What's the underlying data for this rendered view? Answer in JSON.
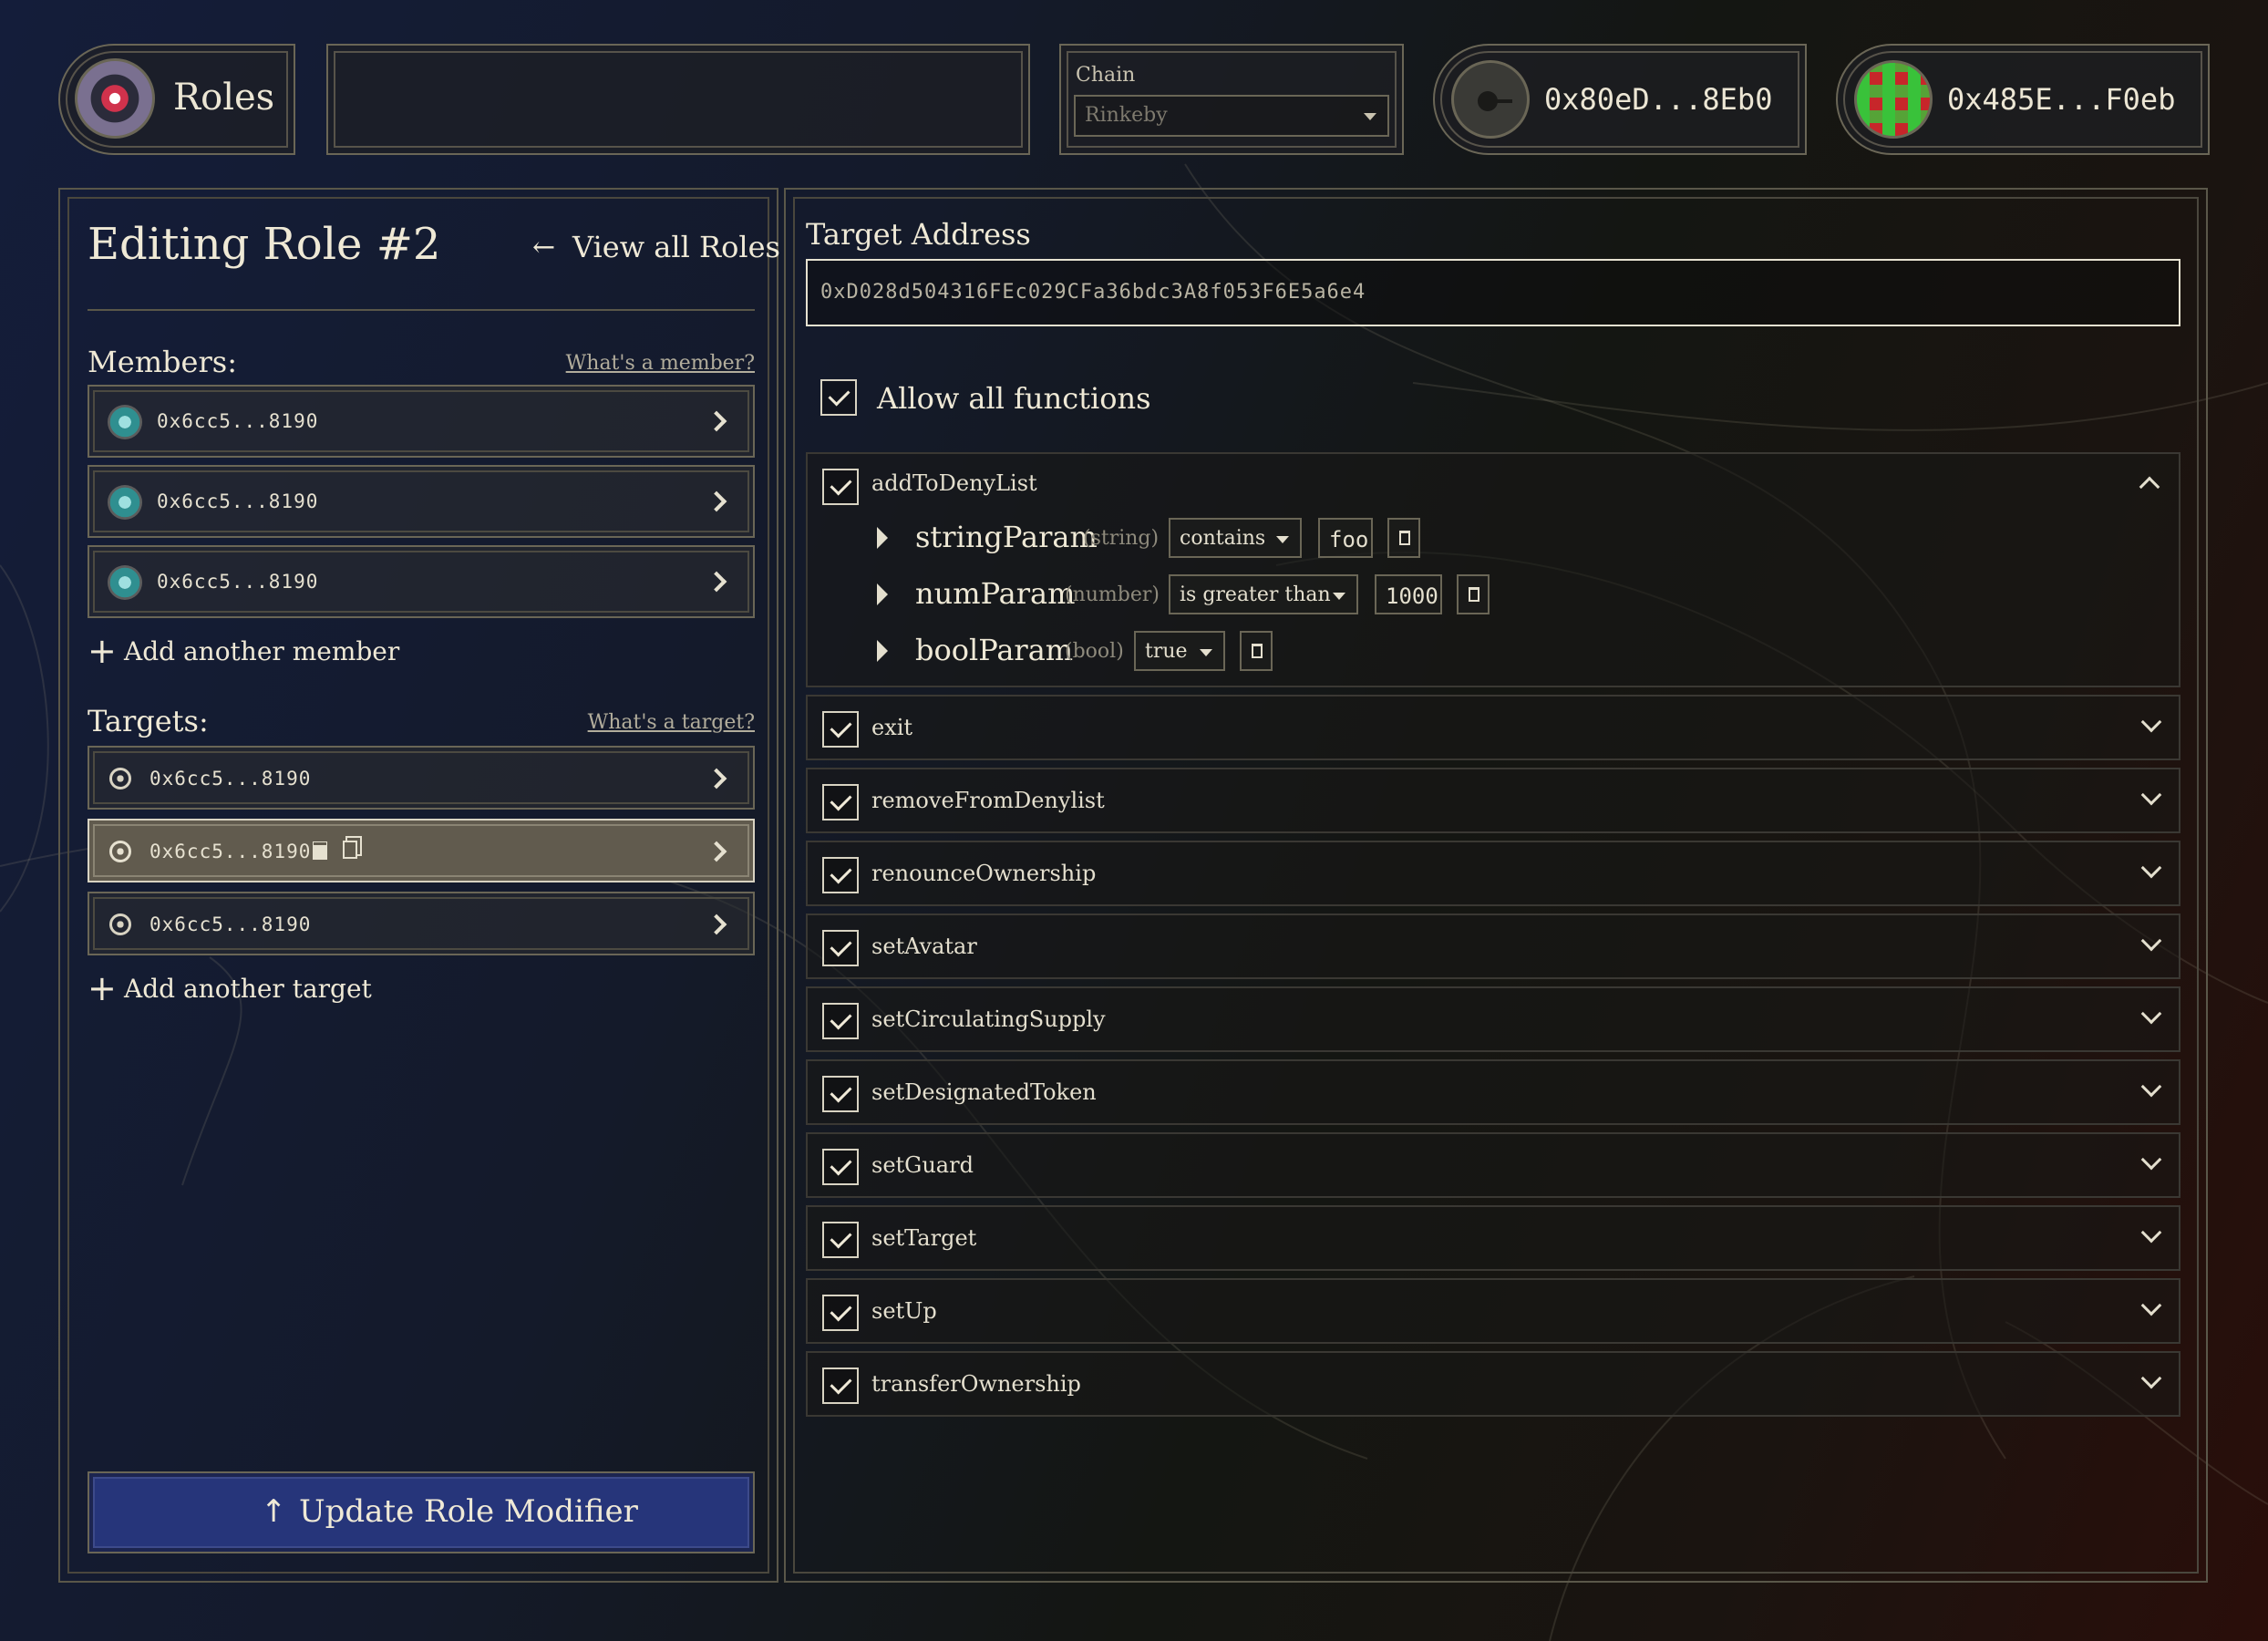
{
  "header": {
    "app_title": "Roles",
    "chain_label": "Chain",
    "chain_selected": "Rinkeby",
    "account1": "0x80eD...8Eb0",
    "account2": "0x485E...F0eb"
  },
  "left": {
    "title": "Editing Role #2",
    "view_all": "View all Roles",
    "members_heading": "Members:",
    "members_help": "What's a member?",
    "members": [
      "0x6cc5...8190",
      "0x6cc5...8190",
      "0x6cc5...8190"
    ],
    "add_member": "Add another member",
    "targets_heading": "Targets:",
    "targets_help": "What's a target?",
    "targets": [
      "0x6cc5...8190",
      "0x6cc5...8190",
      "0x6cc5...8190"
    ],
    "add_target": "Add another target",
    "update_button": "Update Role Modifier"
  },
  "right": {
    "target_address_label": "Target Address",
    "target_address_value": "0xD028d504316FEc029CFa36bdc3A8f053F6E5a6e4",
    "allow_all_label": "Allow all functions",
    "expanded_function": {
      "name": "addToDenyList",
      "params": [
        {
          "name": "stringParam",
          "type": "(string)",
          "condition": "contains",
          "value": "foo"
        },
        {
          "name": "numParam",
          "type": "(number)",
          "condition": "is greater than",
          "value": "1000"
        },
        {
          "name": "boolParam",
          "type": "(bool)",
          "condition": "true",
          "value": ""
        }
      ]
    },
    "functions": [
      "exit",
      "removeFromDenylist",
      "renounceOwnership",
      "setAvatar",
      "setCirculatingSupply",
      "setDesignatedToken",
      "setGuard",
      "setTarget",
      "setUp",
      "transferOwnership"
    ]
  },
  "colors": {
    "button_bg": "#2a3a7a",
    "accent_text": "#e8e3d2",
    "border": "#6a6656"
  }
}
